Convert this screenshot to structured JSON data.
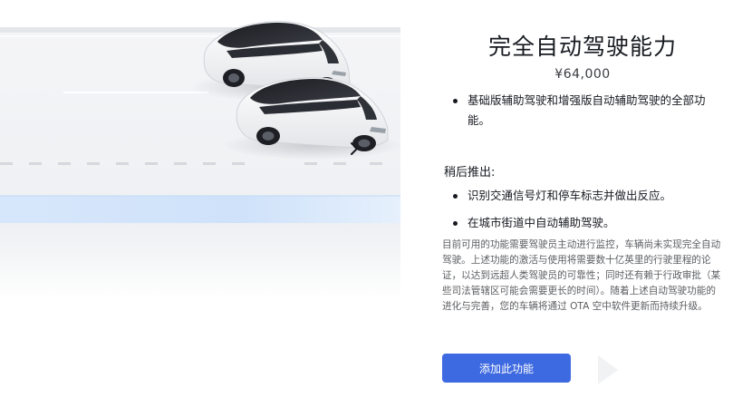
{
  "product": {
    "title": "完全自动驾驶能力",
    "price": "¥64,000"
  },
  "features": [
    "基础版辅助驾驶和增强版自动辅助驾驶的全部功能。"
  ],
  "coming_soon": {
    "label": "稍后推出:",
    "items": [
      "识别交通信号灯和停车标志并做出反应。",
      "在城市街道中自动辅助驾驶。"
    ]
  },
  "disclaimer": "目前可用的功能需要驾驶员主动进行监控，车辆尚未实现完全自动驾驶。上述功能的激活与使用将需要数十亿英里的行驶里程的论证，以达到远超人类驾驶员的可靠性；同时还有赖于行政审批（某些司法管辖区可能会需要更长的时间）。随着上述自动驾驶功能的进化与完善，您的车辆将通过 OTA 空中软件更新而持续升级。",
  "actions": {
    "add_label": "添加此功能"
  },
  "icons": {
    "carousel_next": "chevron-right-icon"
  },
  "colors": {
    "accent": "#3e6ae1",
    "text": "#171a20",
    "muted": "#5c5e62"
  }
}
